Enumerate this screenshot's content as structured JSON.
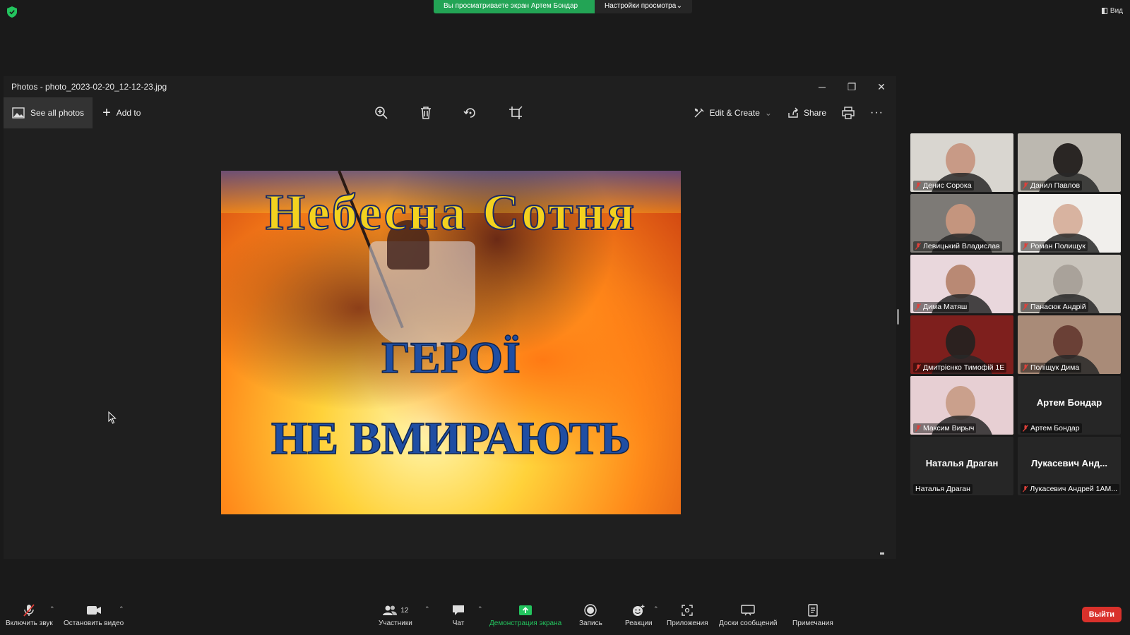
{
  "banner": {
    "sharing_text": "Вы просматриваете экран Артем Бондар",
    "view_options_label": "Настройки просмотра",
    "view_label": "Вид"
  },
  "window": {
    "title": "Photos - photo_2023-02-20_12-12-23.jpg"
  },
  "toolbar": {
    "see_all_photos": "See all photos",
    "add_to": "Add to",
    "edit_create": "Edit & Create",
    "share": "Share"
  },
  "photo": {
    "title_line": "Небесна  Сотня",
    "middle_line": "ГЕРОЇ",
    "bottom_line": "НЕ  ВМИРАЮТЬ"
  },
  "participants": [
    {
      "name": "Денис Сорока",
      "muted": true,
      "video": true,
      "skin": "#c89a86",
      "bg": "#d9d6d0"
    },
    {
      "name": "Данил Павлов",
      "muted": true,
      "video": true,
      "skin": "#2a2624",
      "bg": "#bcb8b0"
    },
    {
      "name": "Левицький Владислав",
      "muted": true,
      "video": true,
      "skin": "#c4957e",
      "bg": "#7d7a76"
    },
    {
      "name": "Роман Полищук",
      "muted": true,
      "video": true,
      "skin": "#d8b3a0",
      "bg": "#f1efec"
    },
    {
      "name": "Дима Матяш",
      "muted": true,
      "video": true,
      "skin": "#b98974",
      "bg": "#e9d7dc"
    },
    {
      "name": "Панасюк Андрій",
      "muted": true,
      "video": true,
      "skin": "#a9a29a",
      "bg": "#c9c4bc"
    },
    {
      "name": "Дмитрієнко Тимофій 1Е",
      "muted": true,
      "video": true,
      "skin": "#2b211f",
      "bg": "#7e1f1d"
    },
    {
      "name": "Поліщук Дима",
      "muted": true,
      "video": true,
      "skin": "#6a4036",
      "bg": "#a98b78"
    },
    {
      "name": "Максим Вирыч",
      "muted": true,
      "video": true,
      "active": true,
      "skin": "#caa08c",
      "bg": "#e7cfd3"
    },
    {
      "name": "Артем Бондар",
      "big_name": "Артем Бондар",
      "muted": true,
      "video": false
    },
    {
      "name": "Наталья Драган",
      "big_name": "Наталья Драган",
      "muted": false,
      "video": false
    },
    {
      "name": "Лукасевич Андрей 1АМ...",
      "big_name": "Лукасевич  Анд...",
      "muted": true,
      "video": false
    }
  ],
  "bottom_bar": {
    "unmute": "Включить звук",
    "stop_video": "Остановить видео",
    "participants": "Участники",
    "participants_count": "12",
    "chat": "Чат",
    "share_screen": "Демонстрация экрана",
    "record": "Запись",
    "reactions": "Реакции",
    "apps": "Приложения",
    "whiteboards": "Доски сообщений",
    "notes": "Примечания",
    "leave": "Выйти"
  },
  "colors": {
    "accent_green": "#23a455",
    "active_speaker": "#d6e34f",
    "leave_red": "#d9312b"
  }
}
